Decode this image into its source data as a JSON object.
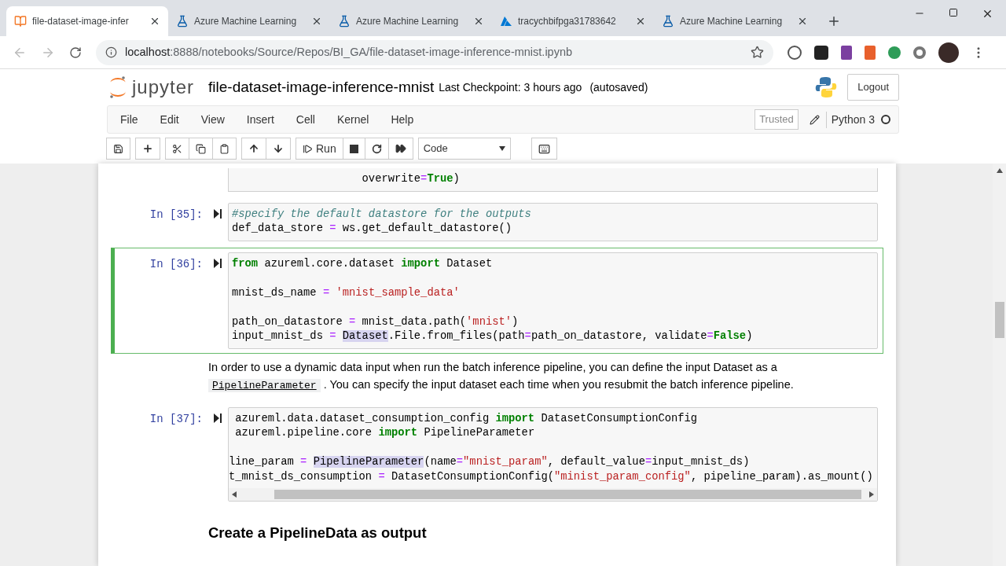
{
  "browser": {
    "tabs": [
      {
        "label": "file-dataset-image-infer",
        "kind": "notebook",
        "selected": true
      },
      {
        "label": "Azure Machine Learning",
        "kind": "flask",
        "selected": false
      },
      {
        "label": "Azure Machine Learning",
        "kind": "flask",
        "selected": false
      },
      {
        "label": "tracychbifpga31783642",
        "kind": "azure",
        "selected": false
      },
      {
        "label": "Azure Machine Learning",
        "kind": "flask",
        "selected": false
      }
    ],
    "address": {
      "host": "localhost",
      "path": ":8888/notebooks/Source/Repos/BI_GA/file-dataset-image-inference-mnist.ipynb"
    }
  },
  "header": {
    "logo": "jupyter",
    "notebook_title": "file-dataset-image-inference-mnist",
    "checkpoint": "Last Checkpoint: 3 hours ago",
    "autosave": "(autosaved)",
    "logout": "Logout"
  },
  "menu": {
    "items": [
      "File",
      "Edit",
      "View",
      "Insert",
      "Cell",
      "Kernel",
      "Help"
    ],
    "trusted": "Trusted",
    "kernel": "Python 3"
  },
  "toolbar": {
    "run": "Run",
    "cell_type": "Code"
  },
  "cells": [
    {
      "kind": "code",
      "selected": false,
      "horizontal_scrollbar": false,
      "lines": [
        {
          "kind": "code",
          "tokens": [
            {
              "kind": "plain",
              "t": "                    overwrite"
            },
            {
              "kind": "op",
              "t": "="
            },
            {
              "kind": "kw",
              "t": "True"
            },
            {
              "kind": "plain",
              "t": ")"
            }
          ]
        }
      ]
    },
    {
      "kind": "code",
      "prompt": "In [35]:",
      "selected": false,
      "horizontal_scrollbar": false,
      "lines": [
        {
          "kind": "code",
          "tokens": [
            {
              "kind": "cm",
              "t": "#specify the default datastore for the outputs"
            }
          ]
        },
        {
          "kind": "code",
          "tokens": [
            {
              "kind": "plain",
              "t": "def_data_store "
            },
            {
              "kind": "op",
              "t": "="
            },
            {
              "kind": "plain",
              "t": " ws.get_default_datastore()"
            }
          ]
        }
      ]
    },
    {
      "kind": "code",
      "prompt": "In [36]:",
      "selected": true,
      "horizontal_scrollbar": false,
      "lines": [
        {
          "kind": "code",
          "tokens": [
            {
              "kind": "kw",
              "t": "from"
            },
            {
              "kind": "plain",
              "t": " azureml.core.dataset "
            },
            {
              "kind": "kw",
              "t": "import"
            },
            {
              "kind": "plain",
              "t": " Dataset"
            }
          ]
        },
        {
          "kind": "blank"
        },
        {
          "kind": "code",
          "tokens": [
            {
              "kind": "plain",
              "t": "mnist_ds_name "
            },
            {
              "kind": "op",
              "t": "="
            },
            {
              "kind": "str",
              "t": " 'mnist_sample_data'"
            }
          ]
        },
        {
          "kind": "blank"
        },
        {
          "kind": "code",
          "tokens": [
            {
              "kind": "plain",
              "t": "path_on_datastore "
            },
            {
              "kind": "op",
              "t": "="
            },
            {
              "kind": "plain",
              "t": " mnist_data.path("
            },
            {
              "kind": "str",
              "t": "'mnist'"
            },
            {
              "kind": "plain",
              "t": ")"
            }
          ]
        },
        {
          "kind": "code",
          "tokens": [
            {
              "kind": "plain",
              "t": "input_mnist_ds "
            },
            {
              "kind": "op",
              "t": "="
            },
            {
              "kind": "hl",
              "t": " Dataset"
            },
            {
              "kind": "plain",
              "t": ".File.from_files(path"
            },
            {
              "kind": "op",
              "t": "="
            },
            {
              "kind": "plain",
              "t": "path_on_datastore, validate"
            },
            {
              "kind": "op",
              "t": "="
            },
            {
              "kind": "kw",
              "t": "False"
            },
            {
              "kind": "plain",
              "t": ")"
            }
          ]
        }
      ]
    },
    {
      "kind": "markdown",
      "parts": [
        {
          "kind": "text",
          "t": "In order to use a dynamic data input when run the batch inference pipeline, you can define the input Dataset as a "
        },
        {
          "kind": "code",
          "t": "PipelineParameter"
        },
        {
          "kind": "text",
          "t": " . You can specify the input dataset each time when you resubmit the batch inference pipeline."
        }
      ]
    },
    {
      "kind": "code",
      "prompt": "In [37]:",
      "selected": false,
      "horizontal_scrollbar": true,
      "lines": [
        {
          "kind": "code",
          "tokens": [
            {
              "kind": "plain",
              "t": " azureml.data.dataset_consumption_config "
            },
            {
              "kind": "kw",
              "t": "import"
            },
            {
              "kind": "plain",
              "t": " DatasetConsumptionConfig"
            }
          ]
        },
        {
          "kind": "code",
          "tokens": [
            {
              "kind": "plain",
              "t": " azureml.pipeline.core "
            },
            {
              "kind": "kw",
              "t": "import"
            },
            {
              "kind": "plain",
              "t": " PipelineParameter"
            }
          ]
        },
        {
          "kind": "blank"
        },
        {
          "kind": "code",
          "tokens": [
            {
              "kind": "plain",
              "t": "line_param "
            },
            {
              "kind": "op",
              "t": "="
            },
            {
              "kind": "hl",
              "t": " PipelineParameter"
            },
            {
              "kind": "plain",
              "t": "(name"
            },
            {
              "kind": "op",
              "t": "="
            },
            {
              "kind": "str",
              "t": "\"mnist_param\""
            },
            {
              "kind": "plain",
              "t": ", default_value"
            },
            {
              "kind": "op",
              "t": "="
            },
            {
              "kind": "plain",
              "t": "input_mnist_ds)"
            }
          ]
        },
        {
          "kind": "code",
          "tokens": [
            {
              "kind": "plain",
              "t": "t_mnist_ds_consumption "
            },
            {
              "kind": "op",
              "t": "="
            },
            {
              "kind": "plain",
              "t": " DatasetConsumptionConfig("
            },
            {
              "kind": "str",
              "t": "\"minist_param_config\""
            },
            {
              "kind": "plain",
              "t": ", pipeline_param).as_mount()"
            }
          ]
        }
      ]
    },
    {
      "kind": "heading",
      "text": "Create a PipelineData as output"
    }
  ]
}
